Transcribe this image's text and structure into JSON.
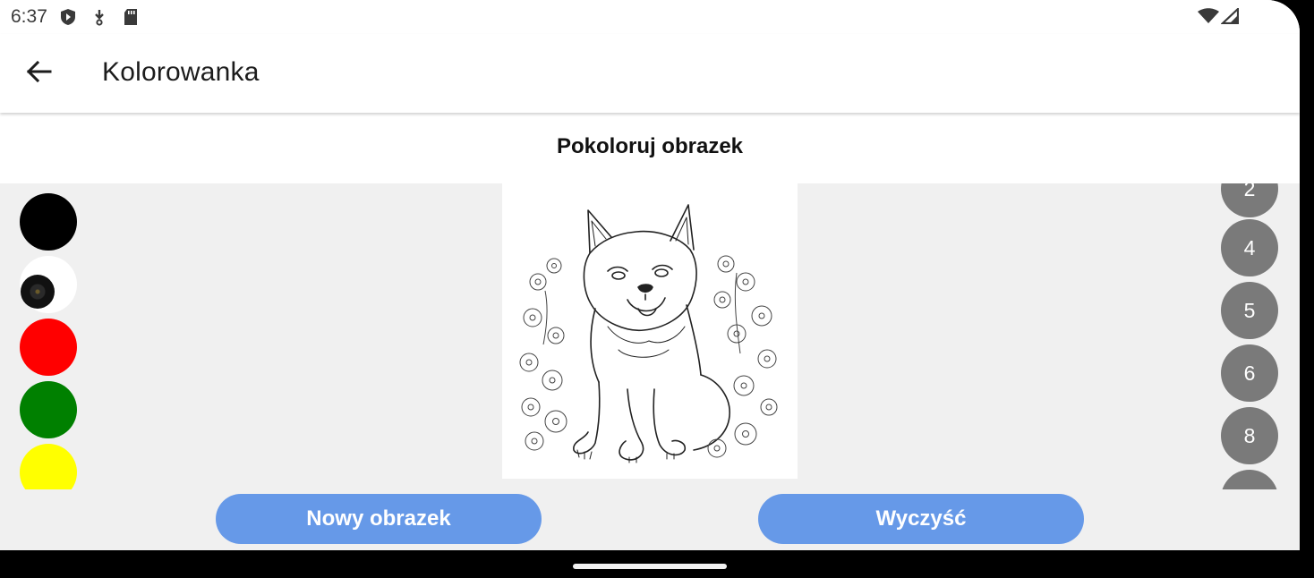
{
  "status_bar": {
    "time": "6:37",
    "icons": [
      "play-protect-icon",
      "download-icon",
      "sd-card-icon",
      "wifi-icon",
      "cellular-icon"
    ]
  },
  "app_bar": {
    "title": "Kolorowanka",
    "back_icon": "arrow-back-icon"
  },
  "subtitle": "Pokoloruj obrazek",
  "palette": {
    "colors": [
      "#000000",
      "#ffffff",
      "#ff0000",
      "#008000",
      "#ffff00"
    ]
  },
  "canvas": {
    "image": "dog-among-flowers-line-art"
  },
  "brush_sizes": [
    "2",
    "4",
    "5",
    "6",
    "8",
    ""
  ],
  "buttons": {
    "new_image": "Nowy obrazek",
    "clear": "Wyczyść"
  },
  "colors": {
    "button_bg": "#6699e8",
    "size_bg": "#7a7a7a",
    "workspace_bg": "#f0f0f0"
  }
}
